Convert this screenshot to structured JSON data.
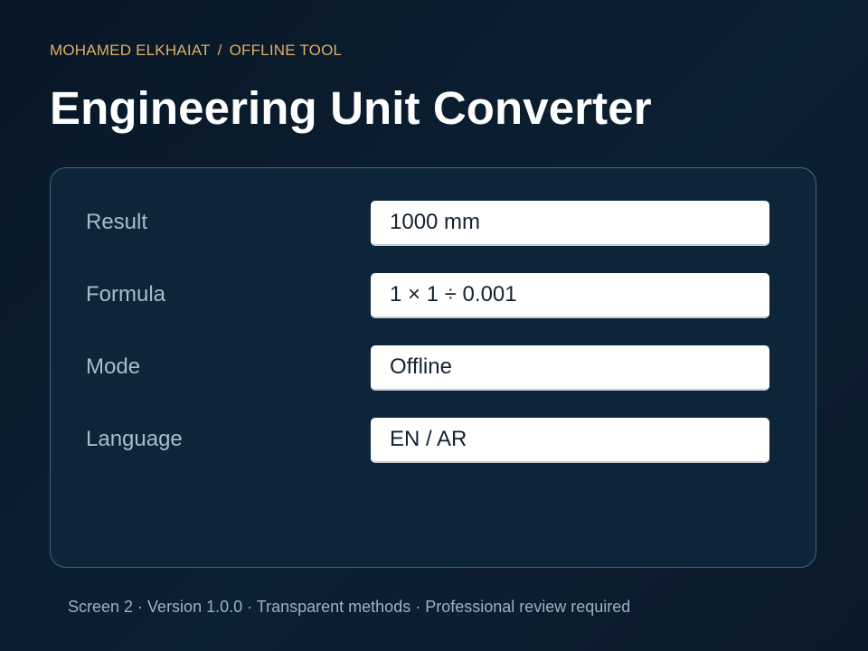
{
  "header": {
    "breadcrumb": {
      "author": "MOHAMED ELKHAIAT",
      "separator": "/",
      "section": "OFFLINE TOOL"
    },
    "title": "Engineering Unit Converter"
  },
  "panel": {
    "fields": [
      {
        "label": "Result",
        "value": "1000 mm"
      },
      {
        "label": "Formula",
        "value": "1 × 1 ÷ 0.001"
      },
      {
        "label": "Mode",
        "value": "Offline"
      },
      {
        "label": "Language",
        "value": "EN / AR"
      }
    ]
  },
  "footer": {
    "text": "Screen 2 · Version 1.0.0 · Transparent methods · Professional review required"
  },
  "colors": {
    "background": "#0a1b2c",
    "panel": "#0e2539",
    "panel_border": "#3e667a",
    "accent": "#e1ae66",
    "title": "#ffffff",
    "label": "#a9bccc",
    "value_box": "#ffffff",
    "value_text": "#152232"
  }
}
